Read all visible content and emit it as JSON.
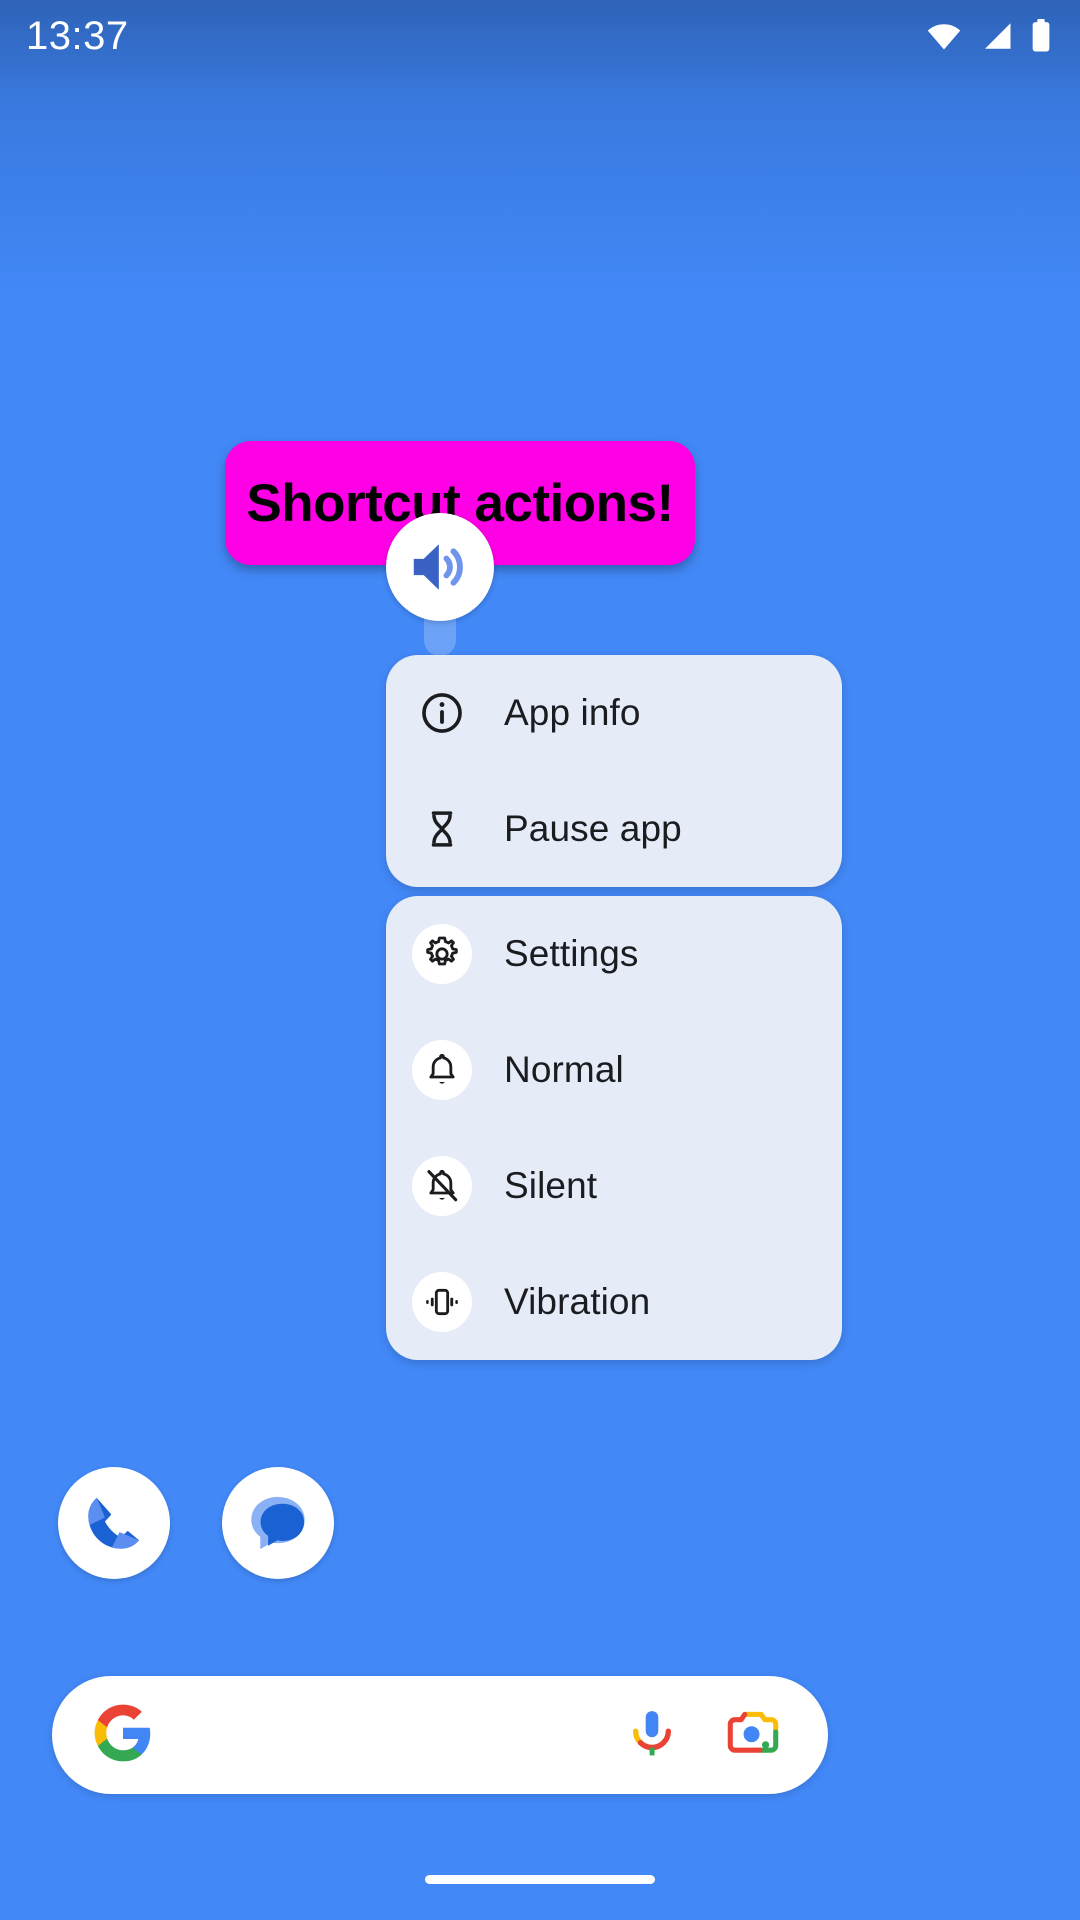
{
  "status_bar": {
    "time": "13:37",
    "icons": [
      "wifi-icon",
      "cellular-signal-icon",
      "battery-icon"
    ]
  },
  "banner": {
    "text": "Shortcut actions!",
    "background_color": "#ff00e6",
    "text_color": "#000000"
  },
  "app_icon": {
    "name": "volume-speaker-icon",
    "accent_color": "#3a62c4"
  },
  "popup_menu": {
    "sections": [
      {
        "id": "system-section",
        "items": [
          {
            "label": "App info",
            "icon": "info-icon",
            "circled": false
          },
          {
            "label": "Pause app",
            "icon": "hourglass-icon",
            "circled": false
          }
        ]
      },
      {
        "id": "shortcut-section",
        "items": [
          {
            "label": "Settings",
            "icon": "gear-icon",
            "circled": true
          },
          {
            "label": "Normal",
            "icon": "bell-icon",
            "circled": true
          },
          {
            "label": "Silent",
            "icon": "bell-off-icon",
            "circled": true
          },
          {
            "label": "Vibration",
            "icon": "vibrate-icon",
            "circled": true
          }
        ]
      }
    ],
    "background_color": "#e6ebf8",
    "text_color": "#1b1c1f"
  },
  "dock": {
    "items": [
      {
        "label": "Phone",
        "icon": "phone-icon"
      },
      {
        "label": "Messages",
        "icon": "messages-icon"
      }
    ]
  },
  "search_bar": {
    "logo": "google-g-logo",
    "placeholder": "",
    "value": "",
    "actions": [
      {
        "name": "voice-search-button",
        "icon": "microphone-icon"
      },
      {
        "name": "lens-search-button",
        "icon": "google-lens-icon"
      }
    ]
  },
  "navigation": {
    "gesture_pill": "home-gesture-pill"
  },
  "wallpaper": {
    "color": "#4288f7"
  }
}
